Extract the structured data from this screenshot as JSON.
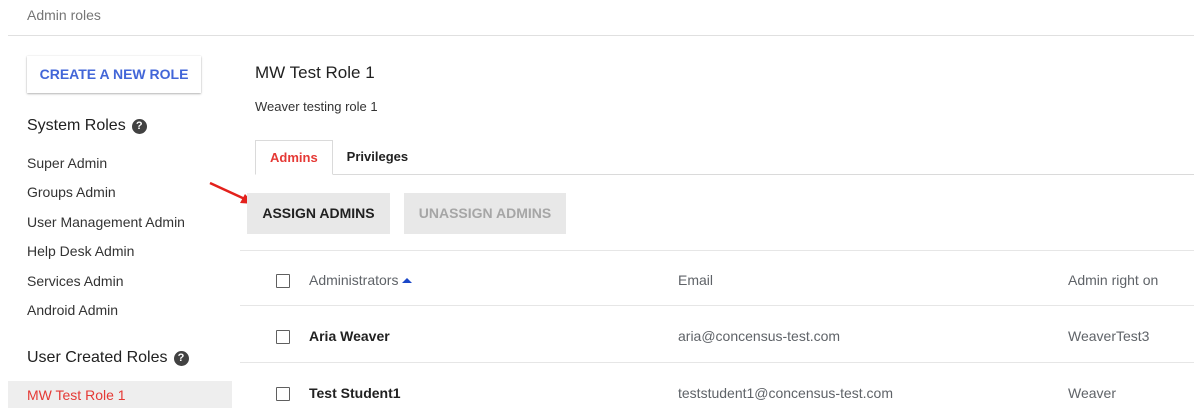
{
  "breadcrumb": "Admin roles",
  "sidebar": {
    "create_button": "CREATE A NEW ROLE",
    "system_roles_heading": "System Roles",
    "system_roles": [
      {
        "label": "Super Admin"
      },
      {
        "label": "Groups Admin"
      },
      {
        "label": "User Management Admin"
      },
      {
        "label": "Help Desk Admin"
      },
      {
        "label": "Services Admin"
      },
      {
        "label": "Android Admin"
      }
    ],
    "user_roles_heading": "User Created Roles",
    "user_roles": [
      {
        "label": "MW Test Role 1",
        "selected": true
      }
    ]
  },
  "role": {
    "title": "MW Test Role 1",
    "description": "Weaver testing role 1"
  },
  "tabs": [
    {
      "label": "Admins",
      "active": true
    },
    {
      "label": "Privileges",
      "active": false
    }
  ],
  "actions": {
    "assign": "ASSIGN ADMINS",
    "unassign": "UNASSIGN ADMINS"
  },
  "table": {
    "columns": [
      "Administrators",
      "Email",
      "Admin right on"
    ],
    "sorted_column": "Administrators",
    "rows": [
      {
        "name": "Aria Weaver",
        "email": "aria@concensus-test.com",
        "scope": "WeaverTest3"
      },
      {
        "name": "Test Student1",
        "email": "teststudent1@concensus-test.com",
        "scope": "Weaver"
      }
    ]
  },
  "colors": {
    "accent_blue": "#4266d8",
    "active_red": "#e53935",
    "button_gray": "#e8e8e8"
  }
}
